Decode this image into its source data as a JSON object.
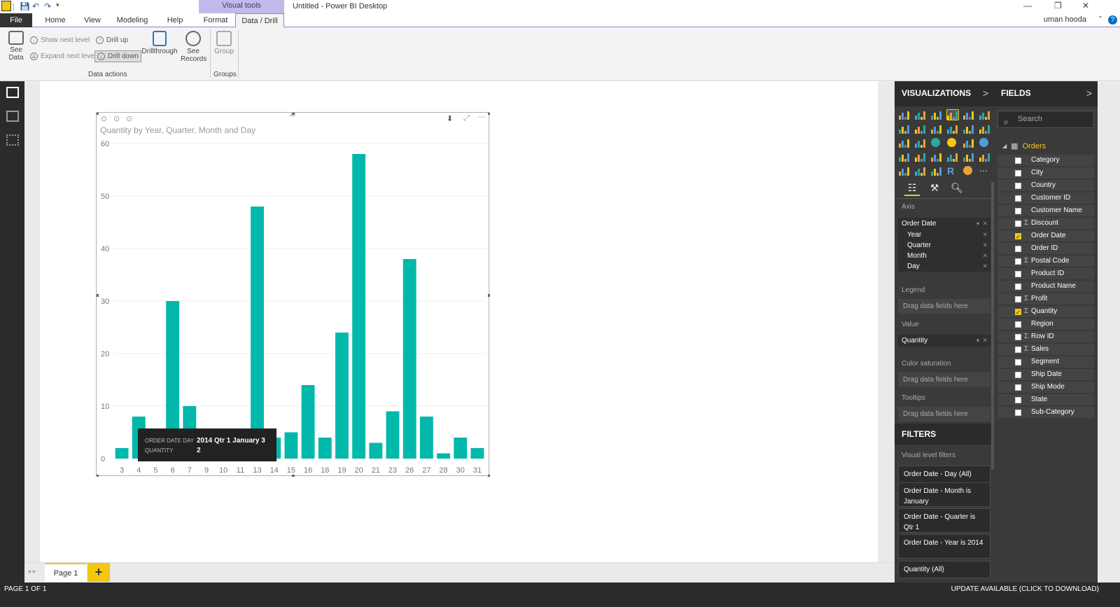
{
  "window": {
    "title": "Untitled - Power BI Desktop",
    "contextual_tab_header": "Visual tools",
    "user": "uman hooda",
    "help": "?"
  },
  "tabs": [
    "File",
    "Home",
    "View",
    "Modeling",
    "Help",
    "Format",
    "Data / Drill"
  ],
  "ribbon": {
    "see_data": "See\nData",
    "show_next_level": "Show next level",
    "expand_next_level": "Expand next level",
    "drill_up": "Drill up",
    "drill_down": "Drill down",
    "drillthrough": "Drillthrough",
    "see_records": "See\nRecords",
    "group": "Group",
    "group_data_actions": "Data actions",
    "group_groups": "Groups"
  },
  "visual": {
    "title": "Quantity by Year, Quarter, Month and Day"
  },
  "chart_data": {
    "type": "bar",
    "title": "Quantity by Year, Quarter, Month and Day",
    "categories": [
      "3",
      "4",
      "5",
      "6",
      "7",
      "9",
      "10",
      "11",
      "13",
      "14",
      "15",
      "16",
      "18",
      "19",
      "20",
      "21",
      "23",
      "26",
      "27",
      "28",
      "30",
      "31"
    ],
    "values": [
      2,
      8,
      3,
      30,
      10,
      1,
      1,
      1,
      48,
      4,
      5,
      14,
      4,
      24,
      58,
      3,
      9,
      38,
      8,
      1,
      4,
      2
    ],
    "ylim": [
      0,
      60
    ],
    "yticks": [
      0,
      10,
      20,
      30,
      40,
      50,
      60
    ],
    "color": "#01b8aa",
    "grid": true
  },
  "tooltip": {
    "key1": "ORDER DATE DAY",
    "val1": "2014 Qtr 1 January 3",
    "key2": "QUANTITY",
    "val2": "2"
  },
  "pages": {
    "page1": "Page 1",
    "add": "+"
  },
  "status": {
    "page": "PAGE 1 OF 1",
    "update": "UPDATE AVAILABLE (CLICK TO DOWNLOAD)"
  },
  "viz_pane": {
    "title": "VISUALIZATIONS",
    "chevron": ">",
    "axis_label": "Axis",
    "axis_field": "Order Date",
    "axis_levels": [
      "Year",
      "Quarter",
      "Month",
      "Day"
    ],
    "legend_label": "Legend",
    "value_label": "Value",
    "value_field": "Quantity",
    "color_sat_label": "Color saturation",
    "tooltips_label": "Tooltips",
    "drag_hint": "Drag data fields here",
    "accent": "#f2c811"
  },
  "filters": {
    "title": "FILTERS",
    "visual_level": "Visual level filters",
    "items": [
      "Order Date - Day (All)",
      "Order Date - Month is January",
      "Order Date - Quarter is Qtr 1",
      "Order Date - Year is 2014",
      "Quantity (All)"
    ]
  },
  "fields_pane": {
    "title": "FIELDS",
    "chevron": ">",
    "search_placeholder": "Search",
    "table": "Orders",
    "fields": [
      {
        "name": "Category",
        "checked": false,
        "sigma": false
      },
      {
        "name": "City",
        "checked": false,
        "sigma": false
      },
      {
        "name": "Country",
        "checked": false,
        "sigma": false
      },
      {
        "name": "Customer ID",
        "checked": false,
        "sigma": false
      },
      {
        "name": "Customer Name",
        "checked": false,
        "sigma": false
      },
      {
        "name": "Discount",
        "checked": false,
        "sigma": true
      },
      {
        "name": "Order Date",
        "checked": true,
        "sigma": false
      },
      {
        "name": "Order ID",
        "checked": false,
        "sigma": false
      },
      {
        "name": "Postal Code",
        "checked": false,
        "sigma": true
      },
      {
        "name": "Product ID",
        "checked": false,
        "sigma": false
      },
      {
        "name": "Product Name",
        "checked": false,
        "sigma": false
      },
      {
        "name": "Profit",
        "checked": false,
        "sigma": true
      },
      {
        "name": "Quantity",
        "checked": true,
        "sigma": true
      },
      {
        "name": "Region",
        "checked": false,
        "sigma": false
      },
      {
        "name": "Row ID",
        "checked": false,
        "sigma": true
      },
      {
        "name": "Sales",
        "checked": false,
        "sigma": true
      },
      {
        "name": "Segment",
        "checked": false,
        "sigma": false
      },
      {
        "name": "Ship Date",
        "checked": false,
        "sigma": false
      },
      {
        "name": "Ship Mode",
        "checked": false,
        "sigma": false
      },
      {
        "name": "State",
        "checked": false,
        "sigma": false
      },
      {
        "name": "Sub-Category",
        "checked": false,
        "sigma": false
      }
    ]
  }
}
